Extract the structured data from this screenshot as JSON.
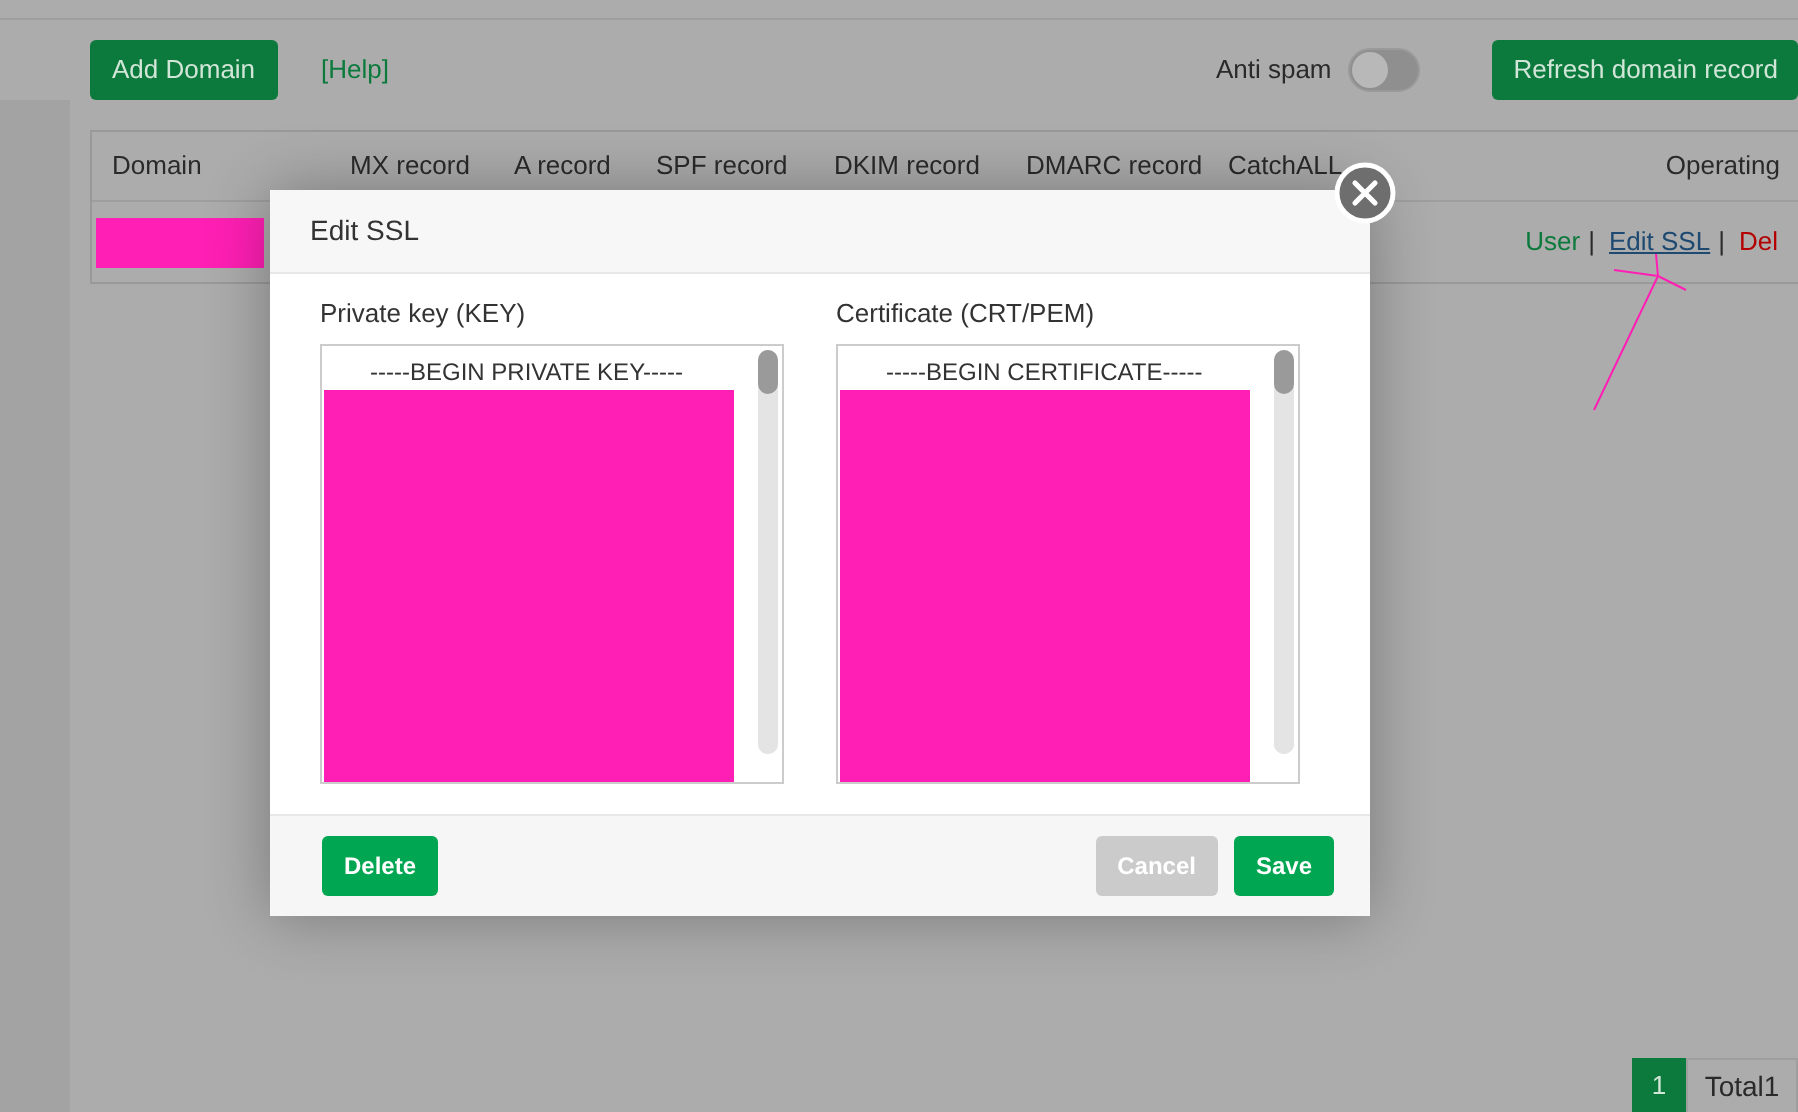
{
  "toolbar": {
    "add_button": "Add Domain",
    "help_link": "[Help]",
    "anti_spam": {
      "label": "Anti spam",
      "on": false
    },
    "refresh_button": "Refresh domain record"
  },
  "table": {
    "columns": [
      "Domain",
      "MX record",
      "A record",
      "SPF record",
      "DKIM record",
      "DMARC record",
      "CatchALL",
      "Operating"
    ],
    "rows": [
      {
        "redacted": true,
        "actions": [
          {
            "kind": "user",
            "label": "User"
          },
          {
            "kind": "separator",
            "label": "|"
          },
          {
            "kind": "edit",
            "label": "Edit SSL"
          },
          {
            "kind": "separator",
            "label": "|"
          },
          {
            "kind": "delete",
            "label": "Del"
          }
        ]
      }
    ]
  },
  "pagination": {
    "pages": [
      {
        "label": "1",
        "selected": true
      }
    ],
    "total": "Total1"
  },
  "modal": {
    "title": "Edit SSL",
    "fields": [
      {
        "label": "Private key (KEY)",
        "value": "-----BEGIN PRIVATE KEY-----",
        "redacted": true
      },
      {
        "label": "Certificate (CRT/PEM)",
        "value": "-----BEGIN CERTIFICATE-----",
        "redacted": true
      }
    ],
    "buttons": [
      {
        "kind": "danger",
        "label": "Delete"
      },
      {
        "kind": "cancel",
        "label": "Cancel"
      },
      {
        "kind": "primary",
        "label": "Save"
      }
    ]
  }
}
